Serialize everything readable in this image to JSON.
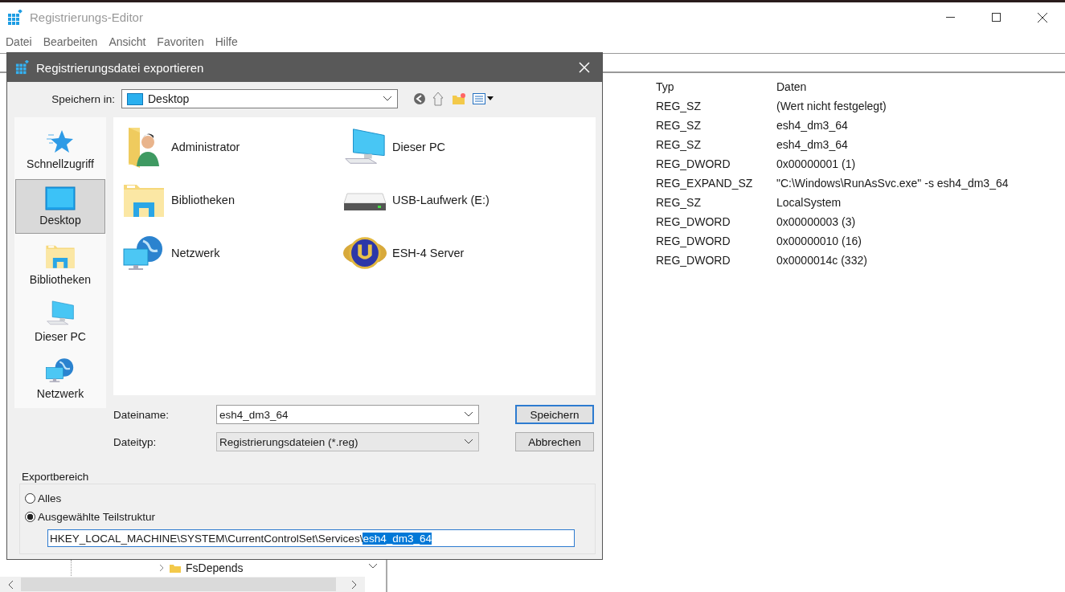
{
  "window": {
    "title": "Registrierungs-Editor"
  },
  "menu": [
    "Datei",
    "Bearbeiten",
    "Ansicht",
    "Favoriten",
    "Hilfe"
  ],
  "tree": {
    "items": [
      {
        "label": "FsDepends"
      }
    ]
  },
  "values": {
    "columns": [
      "Typ",
      "Daten"
    ],
    "rows": [
      {
        "type": "REG_SZ",
        "data": "(Wert nicht festgelegt)"
      },
      {
        "type": "REG_SZ",
        "data": "esh4_dm3_64"
      },
      {
        "type": "REG_SZ",
        "data": "esh4_dm3_64"
      },
      {
        "type": "REG_DWORD",
        "data": "0x00000001 (1)"
      },
      {
        "type": "REG_EXPAND_SZ",
        "data": "\"C:\\Windows\\RunAsSvc.exe\" -s esh4_dm3_64"
      },
      {
        "type": "REG_SZ",
        "data": "LocalSystem"
      },
      {
        "type": "REG_DWORD",
        "data": "0x00000003 (3)"
      },
      {
        "type": "REG_DWORD",
        "data": "0x00000010 (16)"
      },
      {
        "type": "REG_DWORD",
        "data": "0x0000014c (332)"
      }
    ]
  },
  "dialog": {
    "title": "Registrierungsdatei exportieren",
    "save_in": {
      "label": "Speichern in:",
      "value": "Desktop"
    },
    "places": [
      {
        "label": "Schnellzugriff",
        "kind": "star",
        "selected": false
      },
      {
        "label": "Desktop",
        "kind": "desktop",
        "selected": true
      },
      {
        "label": "Bibliotheken",
        "kind": "library",
        "selected": false
      },
      {
        "label": "Dieser PC",
        "kind": "pc",
        "selected": false
      },
      {
        "label": "Netzwerk",
        "kind": "network",
        "selected": false
      }
    ],
    "files": [
      {
        "name": "Administrator",
        "kind": "user"
      },
      {
        "name": "Dieser PC",
        "kind": "pc"
      },
      {
        "name": "Bibliotheken",
        "kind": "library"
      },
      {
        "name": "USB-Laufwerk (E:)",
        "kind": "drive"
      },
      {
        "name": "Netzwerk",
        "kind": "network"
      },
      {
        "name": "ESH-4 Server",
        "kind": "app"
      }
    ],
    "filename": {
      "label": "Dateiname:",
      "value": "esh4_dm3_64"
    },
    "filetype": {
      "label": "Dateityp:",
      "value": "Registrierungsdateien (*.reg)"
    },
    "buttons": [
      "Speichern",
      "Abbrechen"
    ],
    "export_range": {
      "title": "Exportbereich",
      "options": [
        {
          "label": "Alles",
          "selected": false
        },
        {
          "label": "Ausgewählte Teilstruktur",
          "selected": true
        }
      ],
      "path": {
        "text": "HKEY_LOCAL_MACHINE\\SYSTEM\\CurrentControlSet\\Services\\",
        "selection": "esh4_dm3_64"
      }
    }
  }
}
